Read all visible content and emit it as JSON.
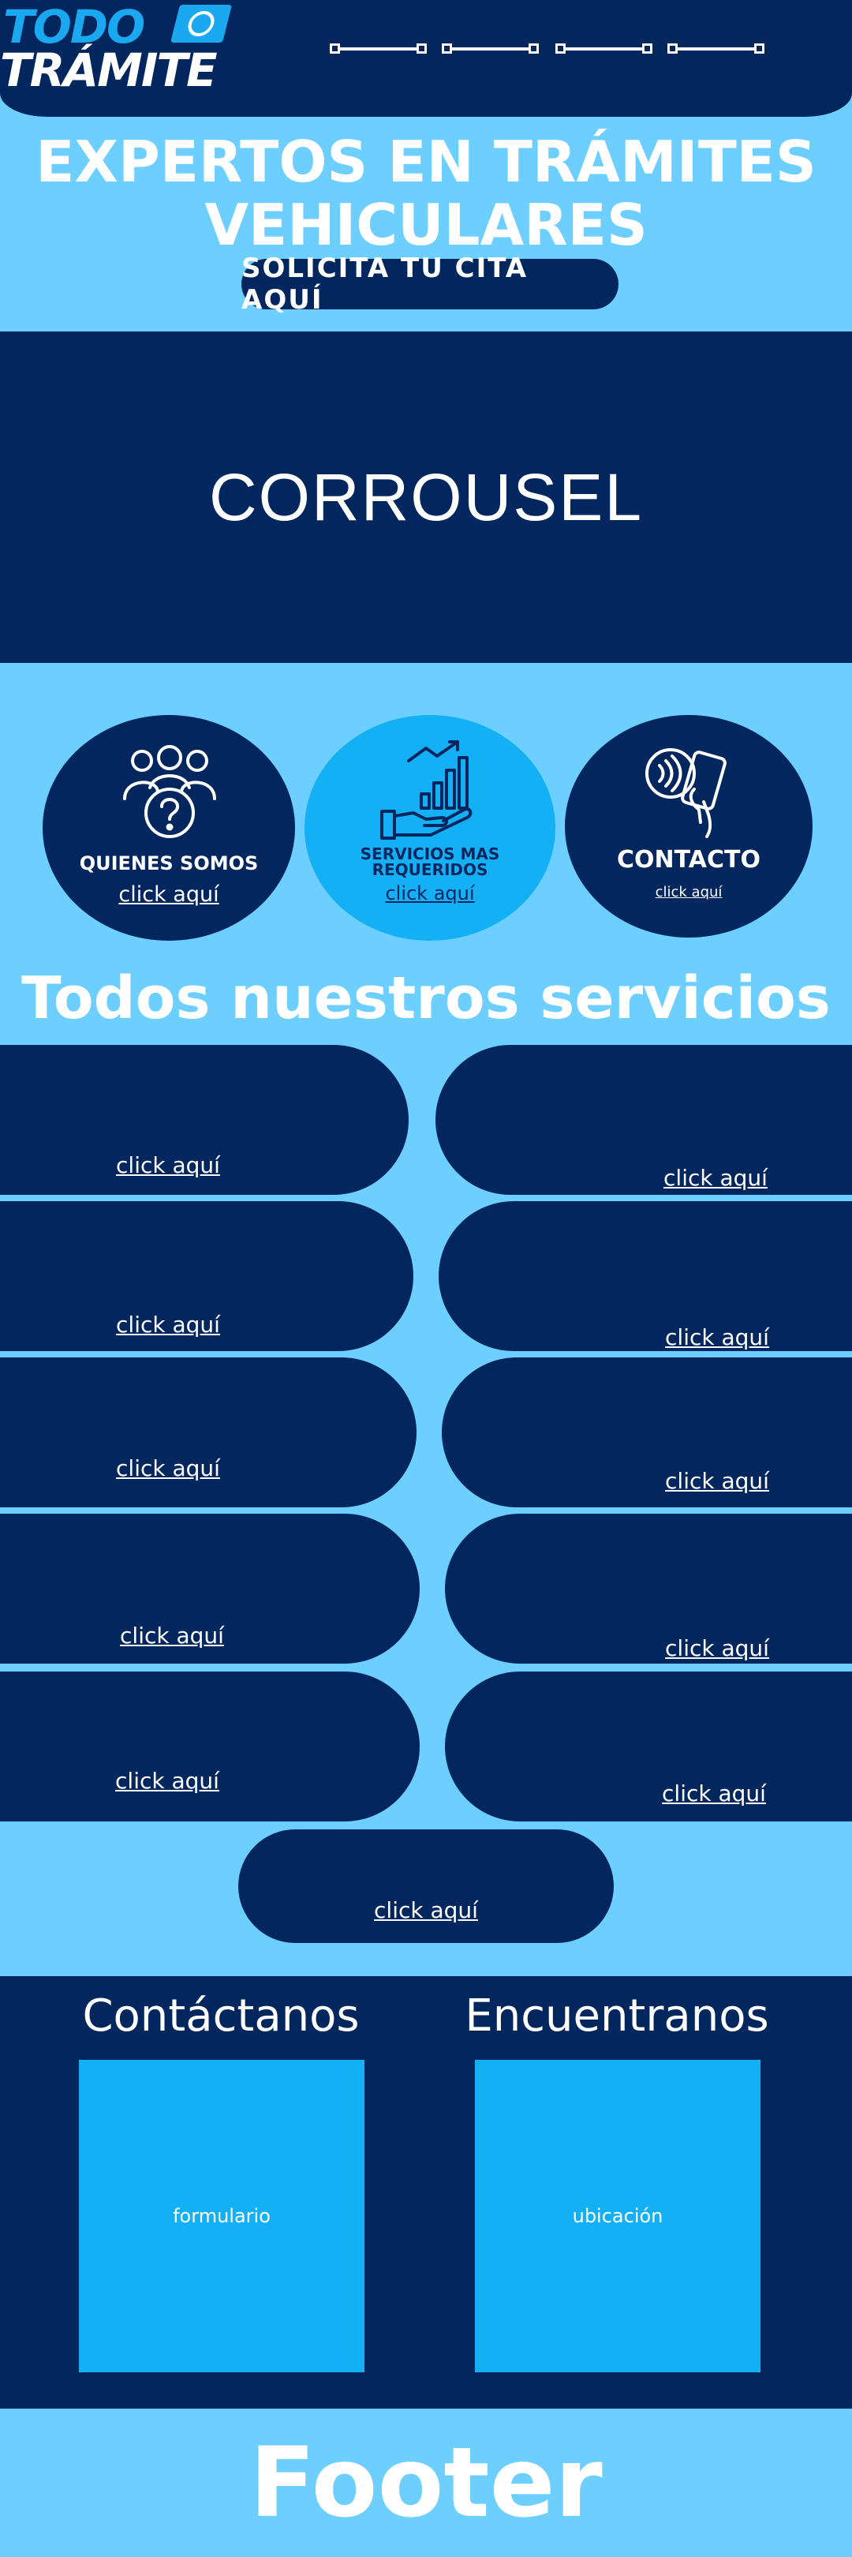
{
  "header": {
    "logo_top": "TODO",
    "logo_bottom": "TRÁMITE",
    "nav_items": 4
  },
  "hero": {
    "title_line1": "EXPERTOS EN TRÁMITES",
    "title_line2": "VEHICULARES",
    "cta_label": "SOLICITA TU CITA AQUÍ"
  },
  "carousel": {
    "label": "CORROUSEL"
  },
  "circles": [
    {
      "label": "QUIENES SOMOS",
      "link": "click aquí",
      "icon": "people-question-icon"
    },
    {
      "label_line1": "SERVICIOS MAS",
      "label_line2": "REQUERIDOS",
      "link": "click aquí",
      "icon": "hand-growth-chart-icon"
    },
    {
      "label": "CONTACTO",
      "link": "click aquí",
      "icon": "phone-contactless-icon"
    }
  ],
  "services": {
    "title": "Todos nuestros servicios",
    "items": [
      {
        "link": "click aquí"
      },
      {
        "link": "click aquí"
      },
      {
        "link": "click aquí"
      },
      {
        "link": "click aquí"
      },
      {
        "link": "click aquí"
      },
      {
        "link": "click aquí"
      },
      {
        "link": "click aquí"
      },
      {
        "link": "click aquí"
      },
      {
        "link": "click aquí"
      },
      {
        "link": "click aquí"
      },
      {
        "link": "click aquí"
      }
    ]
  },
  "contact": {
    "title_left": "Contáctanos",
    "title_right": "Encuentranos",
    "box_left": "formulario",
    "box_right": "ubicación"
  },
  "footer": {
    "label": "Footer"
  },
  "colors": {
    "navy": "#02275e",
    "sky": "#6ccfff",
    "accent": "#14b0f6"
  }
}
